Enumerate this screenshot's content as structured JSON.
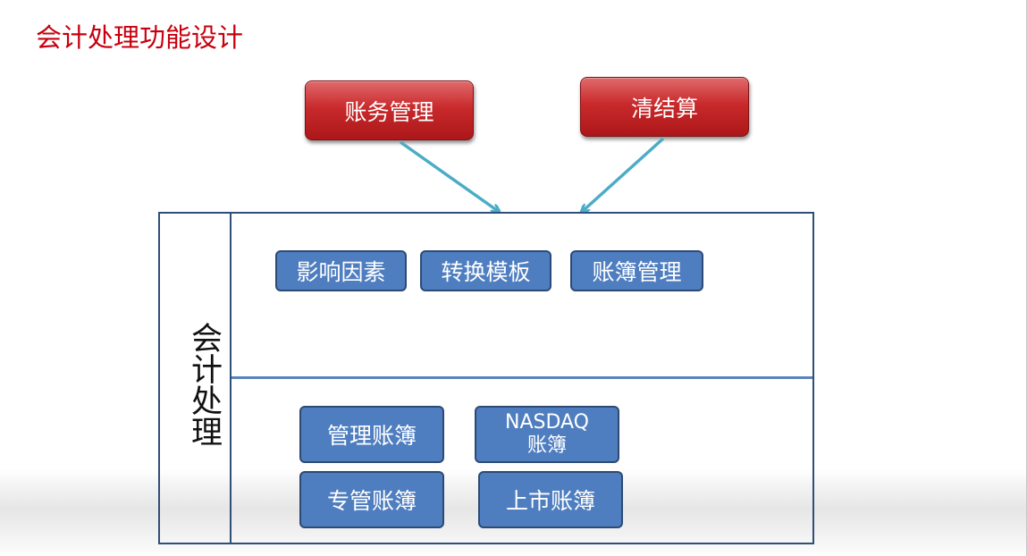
{
  "title": "会计处理功能设计",
  "top_modules": [
    {
      "label": "账务管理"
    },
    {
      "label": "清结算"
    }
  ],
  "side_label": "会计处理",
  "upper_items": [
    {
      "label": "影响因素"
    },
    {
      "label": "转换模板"
    },
    {
      "label": "账簿管理"
    }
  ],
  "lower_items": [
    {
      "label": "管理账簿"
    },
    {
      "line1": "NASDAQ",
      "line2": "账簿"
    },
    {
      "label": "专管账簿"
    },
    {
      "label": "上市账簿"
    }
  ],
  "colors": {
    "title": "#c8000e",
    "red_box": "#c92a2c",
    "blue_box": "#4f7ec0",
    "frame": "#2f4f7a",
    "arrow": "#4bacc6"
  }
}
